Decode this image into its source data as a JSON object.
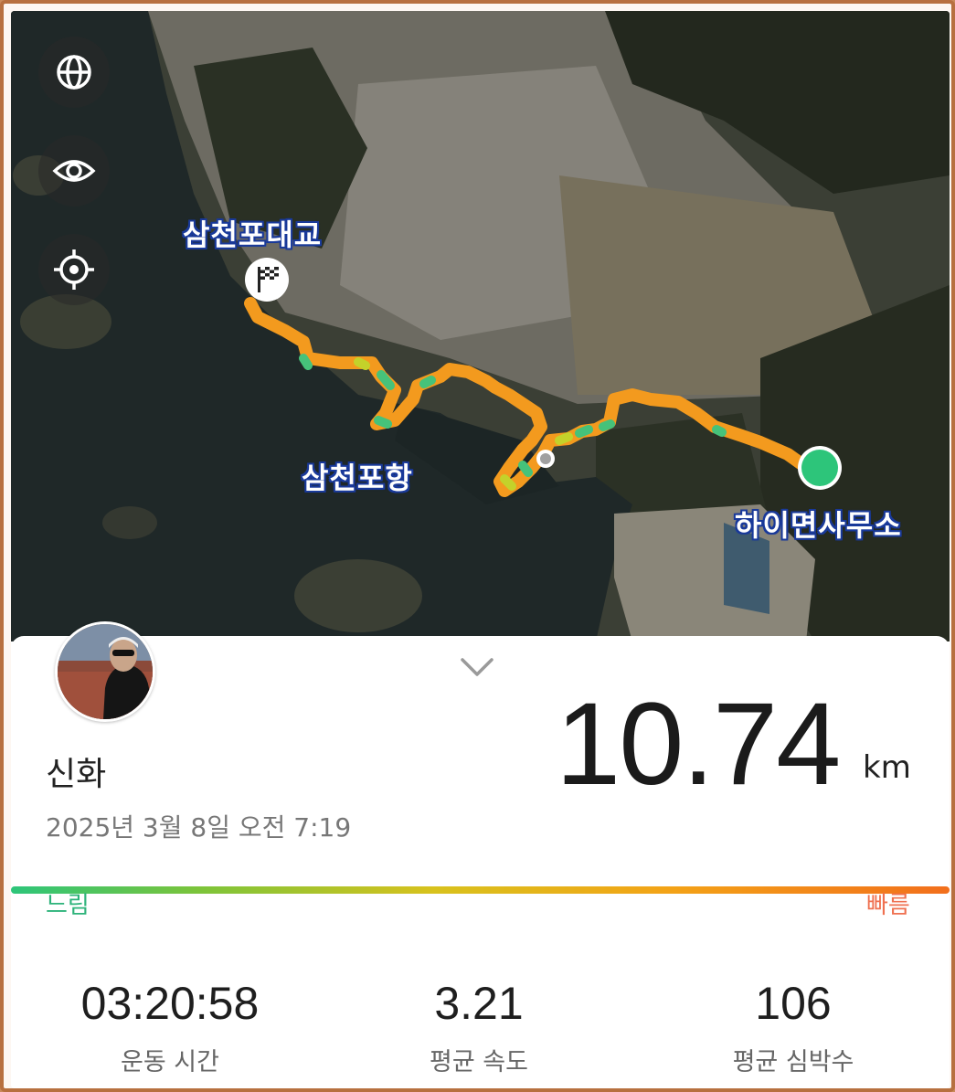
{
  "map": {
    "labels": {
      "finish": "삼천포대교",
      "harbor": "삼천포항",
      "start": "하이면사무소"
    },
    "controls": [
      {
        "name": "globe-icon"
      },
      {
        "name": "eye-icon"
      },
      {
        "name": "locate-icon"
      }
    ],
    "route_color": "#f39a1e"
  },
  "workout": {
    "user_name": "신화",
    "datetime": "2025년 3월 8일 오전 7:19",
    "distance_value": "10.74",
    "distance_unit": "km"
  },
  "speed_legend": {
    "slow_label": "느림",
    "fast_label": "빠름",
    "slow_color": "#2dc57a",
    "fast_color": "#f26f1c"
  },
  "stats": [
    {
      "value": "03:20:58",
      "label": "운동 시간"
    },
    {
      "value": "3.21",
      "label": "평균 속도"
    },
    {
      "value": "106",
      "label": "평균 심박수"
    }
  ]
}
